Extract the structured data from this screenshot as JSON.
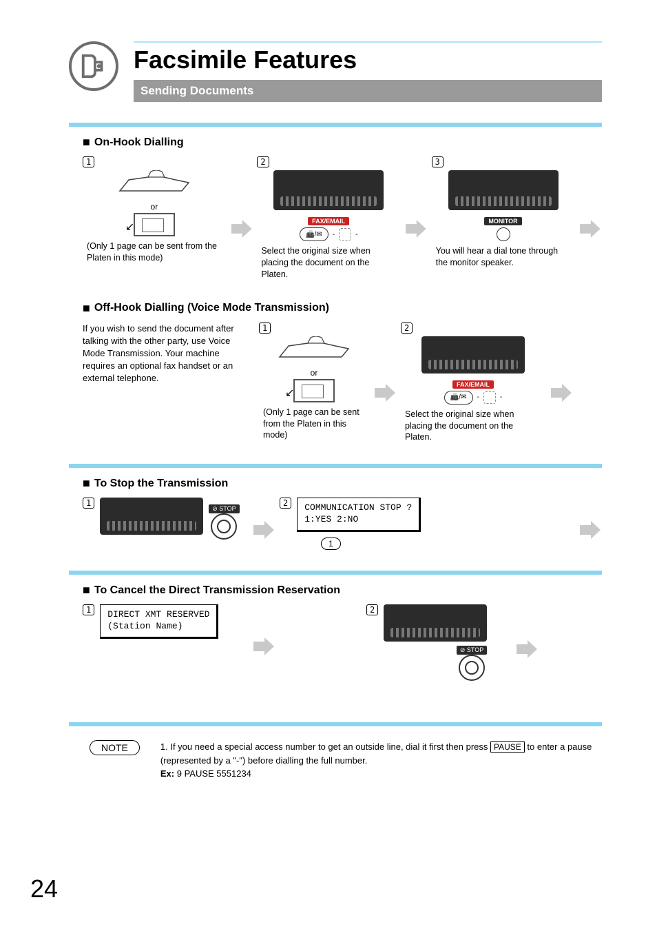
{
  "page_title": "Facsimile Features",
  "subtitle": "Sending Documents",
  "page_number": "24",
  "sections": {
    "on_hook": {
      "heading": "On-Hook Dialling",
      "step1_num": "1",
      "step1_or": "or",
      "step1_caption": "(Only 1 page can be sent from the Platen in this mode)",
      "step2_num": "2",
      "step2_badge": "FAX/EMAIL",
      "step2_caption": "Select the original size when placing the document on the Platen.",
      "step3_num": "3",
      "step3_badge": "MONITOR",
      "step3_caption": "You will hear a dial tone through the monitor speaker."
    },
    "off_hook": {
      "heading": "Off-Hook Dialling (Voice Mode Transmission)",
      "intro": "If you wish to send the document after talking with the other party, use Voice Mode Transmission. Your machine requires an optional fax handset or an external telephone.",
      "step1_num": "1",
      "step1_or": "or",
      "step1_caption": "(Only 1 page can be sent from the Platen in this mode)",
      "step2_num": "2",
      "step2_badge": "FAX/EMAIL",
      "step2_caption": "Select the original size when placing the document on the Platen."
    },
    "stop": {
      "heading": "To Stop the Transmission",
      "step1_num": "1",
      "stop_label": "⊘ STOP",
      "step2_num": "2",
      "lcd_line1": "COMMUNICATION STOP ?",
      "lcd_line2": "1:YES 2:NO",
      "key1": "1"
    },
    "cancel": {
      "heading": "To Cancel the Direct Transmission Reservation",
      "step1_num": "1",
      "lcd_line1": "DIRECT XMT RESERVED",
      "lcd_line2": "(Station Name)",
      "step2_num": "2",
      "stop_label": "⊘ STOP"
    }
  },
  "note": {
    "label": "NOTE",
    "text1": "1. If you need a special access number to get an outside line, dial it first then press ",
    "key": "PAUSE",
    "text2": " to enter a pause (represented by a \"-\") before dialling the full number.",
    "ex_label": "Ex:",
    "ex_value": " 9 PAUSE 5551234"
  }
}
